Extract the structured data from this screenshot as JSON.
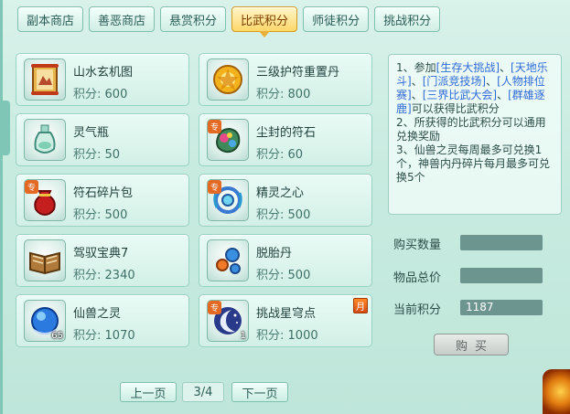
{
  "tabs": [
    {
      "label": "副本商店",
      "active": false
    },
    {
      "label": "善恶商店",
      "active": false
    },
    {
      "label": "悬赏积分",
      "active": false
    },
    {
      "label": "比武积分",
      "active": true
    },
    {
      "label": "师徒积分",
      "active": false
    },
    {
      "label": "挑战积分",
      "active": false
    }
  ],
  "items": [
    {
      "name": "山水玄机图",
      "score_label": "积分:",
      "score": "600",
      "icon": "scroll-map-icon",
      "count": ""
    },
    {
      "name": "三级护符重置丹",
      "score_label": "积分:",
      "score": "800",
      "icon": "gold-pill-icon",
      "count": ""
    },
    {
      "name": "灵气瓶",
      "score_label": "积分:",
      "score": "50",
      "icon": "spirit-bottle-icon",
      "count": ""
    },
    {
      "name": "尘封的符石",
      "score_label": "积分:",
      "score": "60",
      "icon": "rune-stone-icon",
      "count": ""
    },
    {
      "name": "符石碎片包",
      "score_label": "积分:",
      "score": "500",
      "icon": "red-bag-icon",
      "count": ""
    },
    {
      "name": "精灵之心",
      "score_label": "积分:",
      "score": "500",
      "icon": "spirit-heart-icon",
      "count": ""
    },
    {
      "name": "驾驭宝典7",
      "score_label": "积分:",
      "score": "2340",
      "icon": "book-icon",
      "count": ""
    },
    {
      "name": "脱胎丹",
      "score_label": "积分:",
      "score": "500",
      "icon": "pills-icon",
      "count": ""
    },
    {
      "name": "仙兽之灵",
      "score_label": "积分:",
      "score": "1070",
      "icon": "blue-orb-icon",
      "count": "65"
    },
    {
      "name": "挑战星穹点",
      "score_label": "积分:",
      "score": "1000",
      "icon": "moon-icon",
      "count": "1"
    }
  ],
  "badges": {
    "zhuan": "专",
    "month": "月"
  },
  "description": {
    "parts": [
      {
        "t": "1、参加",
        "hl": false
      },
      {
        "t": "[生存大挑战]",
        "hl": true
      },
      {
        "t": "、",
        "hl": false
      },
      {
        "t": "[天地乐斗]",
        "hl": true
      },
      {
        "t": "、",
        "hl": false
      },
      {
        "t": "[门派竞技场]",
        "hl": true
      },
      {
        "t": "、",
        "hl": false
      },
      {
        "t": "[人物排位赛]",
        "hl": true
      },
      {
        "t": "、",
        "hl": false
      },
      {
        "t": "[三界比武大会]",
        "hl": true
      },
      {
        "t": "、",
        "hl": false
      },
      {
        "t": "[群雄逐鹿]",
        "hl": true
      },
      {
        "t": "可以获得比武积分",
        "hl": false
      }
    ],
    "line2": "2、所获得的比武积分可以通用兑换奖励",
    "line3": "3、仙兽之灵每周最多可兑换1个，神兽内丹碎片每月最多可兑换5个"
  },
  "purchase": {
    "qty_label": "购买数量",
    "qty_value": "",
    "total_label": "物品总价",
    "total_value": "",
    "points_label": "当前积分",
    "points_value": "1187",
    "buy_label": "购买"
  },
  "pager": {
    "prev": "上一页",
    "page": "3/4",
    "next": "下一页"
  }
}
